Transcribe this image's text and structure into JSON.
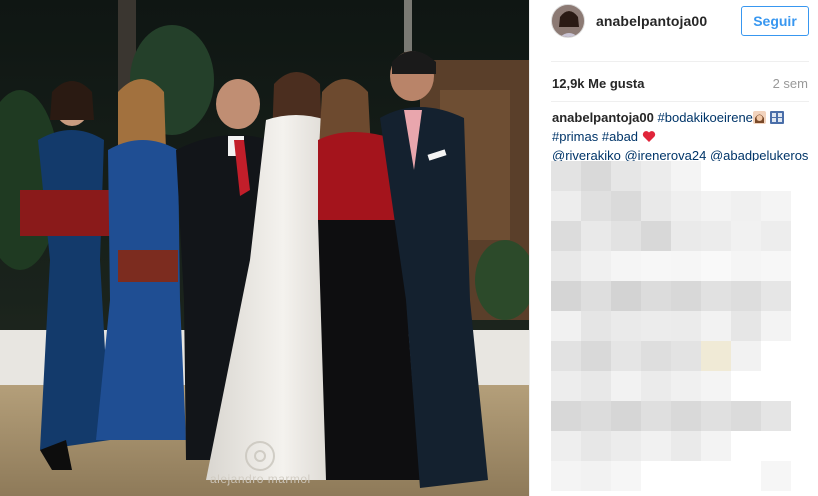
{
  "post": {
    "username": "anabelpantoja00",
    "follow_label": "Seguir",
    "likes": "12,9k Me gusta",
    "time": "2 sem",
    "photo_watermark": "alejandro marmol"
  },
  "caption": {
    "username": "anabelpantoja00",
    "tag1": "#bodakikoeirene",
    "tag2": "#primas",
    "tag3": "#abad",
    "mention1": "@riverakiko",
    "mention2": "@irenerova24",
    "mention3": "@abadpelukeros"
  },
  "icons": [
    "woman-emoji-icon",
    "film-frames-emoji-icon",
    "red-heart-icon",
    "verified-photo-logo-icon"
  ],
  "colors": {
    "accent": "#3897f0",
    "hashtag": "#003569",
    "text": "#262626",
    "muted": "#999999"
  }
}
